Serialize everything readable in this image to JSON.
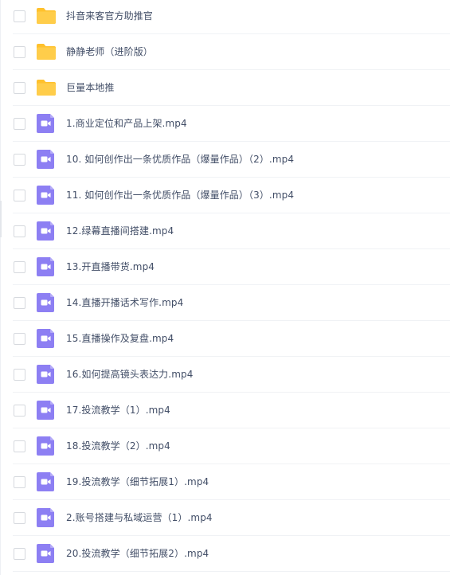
{
  "colors": {
    "folder": "#ffcd4a",
    "folder_back": "#ffc12c",
    "video": "#8d7ff3",
    "text": "#424e67",
    "divider": "#f0f2f5",
    "checkbox_border": "#d6d9de"
  },
  "file_list": {
    "items": [
      {
        "type": "folder",
        "icon": "folder-icon",
        "name": "抖音来客官方助推官"
      },
      {
        "type": "folder",
        "icon": "folder-icon",
        "name": "静静老师（进阶版）"
      },
      {
        "type": "folder",
        "icon": "folder-icon",
        "name": "巨量本地推"
      },
      {
        "type": "video",
        "icon": "video-file-icon",
        "name": "1.商业定位和产品上架.mp4"
      },
      {
        "type": "video",
        "icon": "video-file-icon",
        "name": "10. 如何创作出一条优质作品（爆量作品）（2）.mp4"
      },
      {
        "type": "video",
        "icon": "video-file-icon",
        "name": "11. 如何创作出一条优质作品（爆量作品）（3）.mp4"
      },
      {
        "type": "video",
        "icon": "video-file-icon",
        "name": "12.绿幕直播间搭建.mp4"
      },
      {
        "type": "video",
        "icon": "video-file-icon",
        "name": "13.开直播带货.mp4"
      },
      {
        "type": "video",
        "icon": "video-file-icon",
        "name": "14.直播开播话术写作.mp4"
      },
      {
        "type": "video",
        "icon": "video-file-icon",
        "name": "15.直播操作及复盘.mp4"
      },
      {
        "type": "video",
        "icon": "video-file-icon",
        "name": "16.如何提高镜头表达力.mp4"
      },
      {
        "type": "video",
        "icon": "video-file-icon",
        "name": "17.投流教学（1）.mp4"
      },
      {
        "type": "video",
        "icon": "video-file-icon",
        "name": "18.投流教学（2）.mp4"
      },
      {
        "type": "video",
        "icon": "video-file-icon",
        "name": "19.投流教学（细节拓展1）.mp4"
      },
      {
        "type": "video",
        "icon": "video-file-icon",
        "name": "2.账号搭建与私域运营（1）.mp4"
      },
      {
        "type": "video",
        "icon": "video-file-icon",
        "name": "20.投流教学（细节拓展2）.mp4"
      }
    ]
  }
}
